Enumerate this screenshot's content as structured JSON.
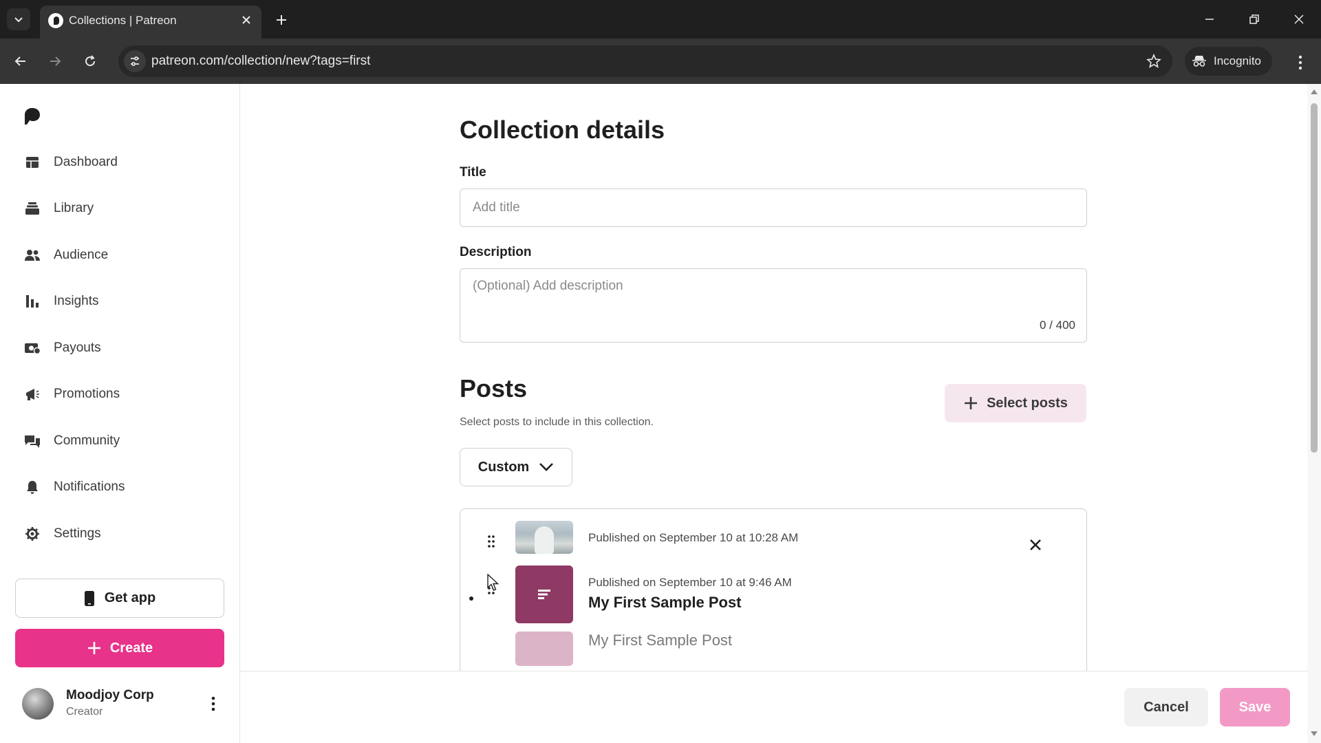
{
  "browser": {
    "tab_title": "Collections | Patreon",
    "url": "patreon.com/collection/new?tags=first",
    "incognito_label": "Incognito"
  },
  "sidebar": {
    "items": [
      {
        "label": "Dashboard",
        "icon": "dashboard-icon"
      },
      {
        "label": "Library",
        "icon": "library-icon"
      },
      {
        "label": "Audience",
        "icon": "audience-icon"
      },
      {
        "label": "Insights",
        "icon": "insights-icon"
      },
      {
        "label": "Payouts",
        "icon": "payouts-icon"
      },
      {
        "label": "Promotions",
        "icon": "promotions-icon"
      },
      {
        "label": "Community",
        "icon": "community-icon"
      },
      {
        "label": "Notifications",
        "icon": "bell-icon"
      },
      {
        "label": "Settings",
        "icon": "gear-icon"
      }
    ],
    "get_app_label": "Get app",
    "create_label": "Create",
    "user": {
      "name": "Moodjoy Corp",
      "role": "Creator"
    }
  },
  "form": {
    "heading": "Collection details",
    "title_label": "Title",
    "title_placeholder": "Add title",
    "title_value": "",
    "description_label": "Description",
    "description_placeholder": "(Optional) Add description",
    "description_value": "",
    "char_count": "0 / 400"
  },
  "posts": {
    "heading": "Posts",
    "subtitle": "Select posts to include in this collection.",
    "select_label": "Select posts",
    "sort_value": "Custom",
    "items": [
      {
        "date": "Published on September 10 at 10:28 AM",
        "title": ""
      },
      {
        "date": "Published on September 10 at 9:46 AM",
        "title": "My First Sample Post"
      },
      {
        "date": "",
        "title": "My First Sample Post"
      }
    ]
  },
  "footer": {
    "cancel_label": "Cancel",
    "save_label": "Save"
  },
  "colors": {
    "brand_pink": "#e8338a",
    "save_disabled": "#f29ac5",
    "select_posts_bg": "#f6e7ef",
    "post_thumb": "#8e3a64"
  }
}
